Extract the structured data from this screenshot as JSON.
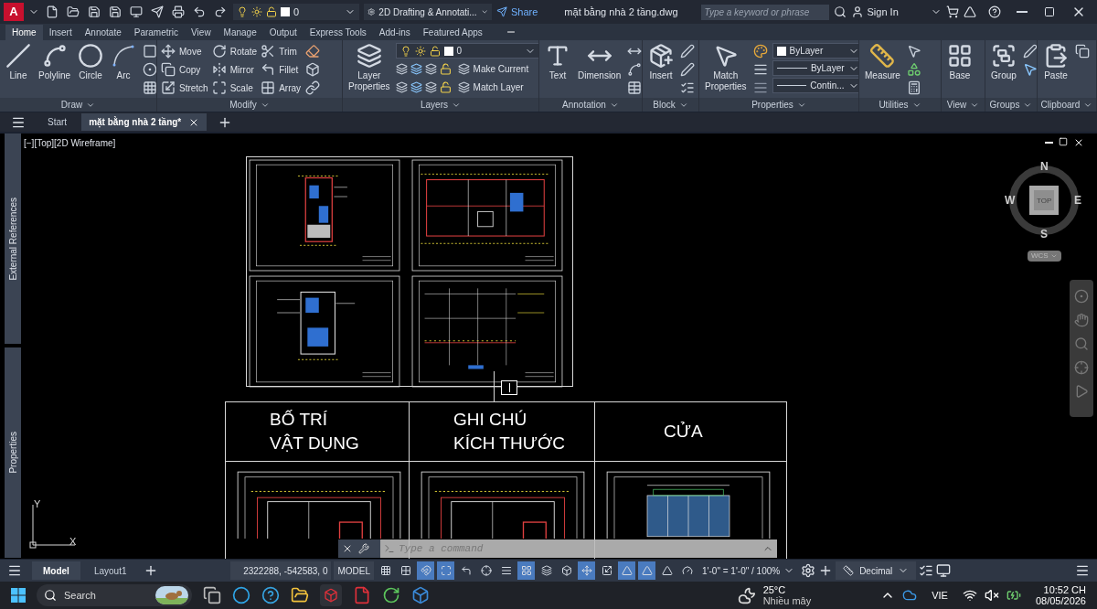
{
  "title_bar": {
    "app_letter": "A",
    "layer": "0",
    "workspace": "2D Drafting & Annotati...",
    "share": "Share",
    "file_title": "mặt bằng nhà 2 tầng.dwg",
    "search_placeholder": "Type a keyword or phrase",
    "sign_in": "Sign In"
  },
  "ribbon_tabs": [
    {
      "label": "Home",
      "selected": true
    },
    {
      "label": "Insert",
      "selected": false
    },
    {
      "label": "Annotate",
      "selected": false
    },
    {
      "label": "Parametric",
      "selected": false
    },
    {
      "label": "View",
      "selected": false
    },
    {
      "label": "Manage",
      "selected": false
    },
    {
      "label": "Output",
      "selected": false
    },
    {
      "label": "Express Tools",
      "selected": false
    },
    {
      "label": "Add-ins",
      "selected": false
    },
    {
      "label": "Featured Apps",
      "selected": false
    }
  ],
  "ribbon_panels": [
    {
      "title": "Draw",
      "groups": [
        {
          "kind": "large",
          "label": "Line"
        },
        {
          "kind": "large",
          "label": "Polyline"
        },
        {
          "kind": "large",
          "label": "Circle"
        },
        {
          "kind": "large",
          "label": "Arc"
        },
        {
          "kind": "stack",
          "items": [
            {
              "kind": "icon"
            },
            {
              "kind": "icon"
            },
            {
              "kind": "icon"
            }
          ]
        }
      ]
    },
    {
      "title": "Modify",
      "groups": [
        {
          "kind": "stack",
          "items": [
            {
              "kind": "small",
              "label": "Move"
            },
            {
              "kind": "small",
              "label": "Copy"
            },
            {
              "kind": "small",
              "label": "Stretch"
            }
          ]
        },
        {
          "kind": "stack",
          "items": [
            {
              "kind": "small",
              "label": "Rotate"
            },
            {
              "kind": "small",
              "label": "Mirror"
            },
            {
              "kind": "small",
              "label": "Scale"
            }
          ]
        },
        {
          "kind": "stack",
          "items": [
            {
              "kind": "small",
              "label": "Trim"
            },
            {
              "kind": "small",
              "label": "Fillet"
            },
            {
              "kind": "small",
              "label": "Array"
            }
          ]
        },
        {
          "kind": "stack",
          "items": [
            {
              "kind": "icon"
            },
            {
              "kind": "icon"
            },
            {
              "kind": "icon"
            }
          ]
        }
      ]
    },
    {
      "title": "Layers",
      "groups": [
        {
          "kind": "large",
          "label": "Layer Properties"
        },
        {
          "kind": "stack",
          "items": [
            {
              "kind": "layer_combo",
              "value": "0"
            },
            {
              "kind": "layer_tool",
              "label": "Make Current"
            },
            {
              "kind": "layer_tool",
              "label": "Match Layer"
            }
          ]
        }
      ]
    },
    {
      "title": "Annotation",
      "groups": [
        {
          "kind": "large",
          "label": "Text"
        },
        {
          "kind": "large",
          "label": "Dimension"
        },
        {
          "kind": "stack",
          "items": [
            {
              "kind": "icon"
            },
            {
              "kind": "icon"
            },
            {
              "kind": "icon"
            }
          ]
        }
      ]
    },
    {
      "title": "Block",
      "groups": [
        {
          "kind": "large",
          "label": "Insert"
        },
        {
          "kind": "stack",
          "items": [
            {
              "kind": "icon"
            },
            {
              "kind": "icon"
            },
            {
              "kind": "icon"
            }
          ]
        }
      ]
    },
    {
      "title": "Properties",
      "groups": [
        {
          "kind": "large",
          "label": "Match Properties"
        },
        {
          "kind": "stack",
          "items": [
            {
              "kind": "icon"
            },
            {
              "kind": "icon"
            },
            {
              "kind": "icon"
            }
          ]
        },
        {
          "kind": "stack",
          "items": [
            {
              "kind": "color_combo",
              "value": "ByLayer"
            },
            {
              "kind": "line_combo",
              "value": "ByLayer"
            },
            {
              "kind": "line_combo",
              "value": "Contin..."
            }
          ]
        }
      ]
    },
    {
      "title": "Utilities",
      "groups": [
        {
          "kind": "large",
          "label": "Measure"
        },
        {
          "kind": "stack",
          "items": [
            {
              "kind": "icon"
            },
            {
              "kind": "icon"
            },
            {
              "kind": "icon"
            }
          ]
        }
      ]
    },
    {
      "title": "View",
      "groups": [
        {
          "kind": "large",
          "label": "Base"
        }
      ]
    },
    {
      "title": "Groups",
      "groups": [
        {
          "kind": "large",
          "label": "Group"
        },
        {
          "kind": "stack",
          "items": [
            {
              "kind": "icon"
            },
            {
              "kind": "icon"
            }
          ]
        }
      ]
    },
    {
      "title": "Clipboard",
      "groups": [
        {
          "kind": "large",
          "label": "Paste"
        },
        {
          "kind": "stack",
          "items": [
            {
              "kind": "icon"
            }
          ]
        }
      ]
    }
  ],
  "document_tabs": [
    {
      "label": "Start",
      "selected": false
    },
    {
      "label": "mặt bằng nhà 2 tầng*",
      "selected": true
    }
  ],
  "viewport": {
    "label": "[−][Top][2D Wireframe]",
    "palettes": [
      "External References",
      "Properties"
    ],
    "table_headers": [
      {
        "lines": [
          "BỐ TRÍ",
          "VẬT DỤNG"
        ]
      },
      {
        "lines": [
          "GHI CHÚ",
          "KÍCH THƯỚC"
        ]
      },
      {
        "lines": [
          "CỬA"
        ]
      }
    ],
    "viewcube": {
      "north": "N",
      "south": "S",
      "east": "E",
      "west": "W",
      "face": "TOP",
      "ucs": "WCS"
    },
    "ucs_axes": {
      "x": "X",
      "y": "Y"
    },
    "command_placeholder": "Type a command"
  },
  "status_bar": {
    "layout_tabs": [
      {
        "label": "Model",
        "selected": true
      },
      {
        "label": "Layout1",
        "selected": false
      }
    ],
    "coordinates": "2322288, -542583, 0",
    "space": "MODEL",
    "toggles": [
      {
        "on": false
      },
      {
        "on": false
      },
      {
        "on": true
      },
      {
        "on": true
      },
      {
        "on": false
      },
      {
        "on": false
      },
      {
        "on": false
      },
      {
        "on": true
      },
      {
        "on": false
      },
      {
        "on": false
      },
      {
        "on": true
      },
      {
        "on": false
      },
      {
        "on": true
      },
      {
        "on": true
      },
      {
        "on": false
      },
      {
        "on": false
      }
    ],
    "annotation_scale": "1'-0\" = 1'-0\" / 100%",
    "units": "Decimal"
  },
  "taskbar": {
    "search": "Search",
    "temperature": "25°C",
    "condition": "Nhiều mây",
    "language": "VIE",
    "time": "10:52 CH",
    "date": "08/05/2026"
  }
}
